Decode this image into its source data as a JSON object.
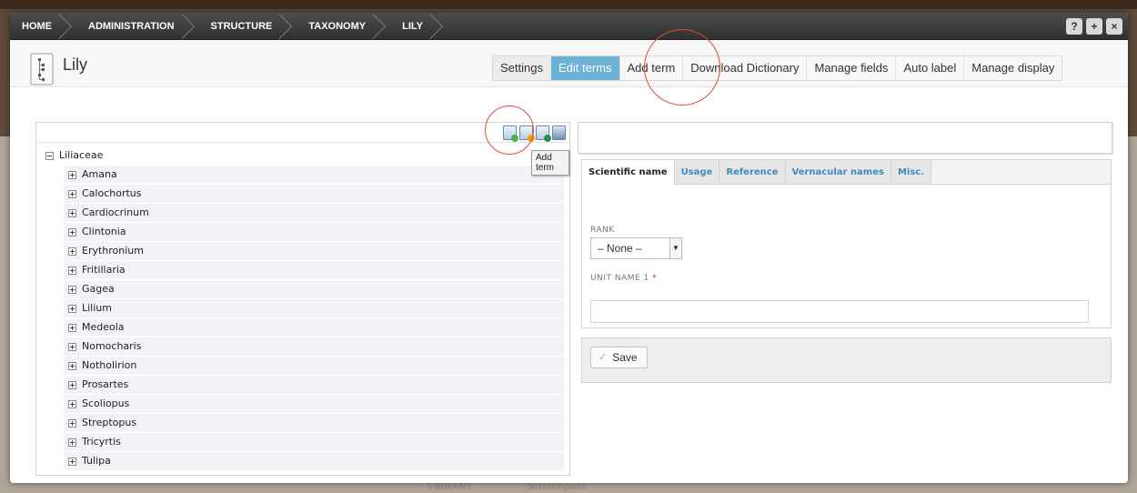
{
  "breadcrumbs": [
    "HOME",
    "ADMINISTRATION",
    "STRUCTURE",
    "TAXONOMY",
    "LILY"
  ],
  "toolbar_buttons": [
    "?",
    "+",
    "×"
  ],
  "page": {
    "title": "Lily",
    "icon": "taxonomy-tree-icon"
  },
  "tabs": [
    {
      "label": "Settings",
      "active": false
    },
    {
      "label": "Edit terms",
      "active": true
    },
    {
      "label": "Add term",
      "active": false
    },
    {
      "label": "Download Dictionary",
      "active": false
    },
    {
      "label": "Manage fields",
      "active": false
    },
    {
      "label": "Auto label",
      "active": false
    },
    {
      "label": "Manage display",
      "active": false
    }
  ],
  "tree_tools": [
    "add-term-icon",
    "add-child-term-icon",
    "move-term-icon",
    "print-icon"
  ],
  "tooltip": "Add term",
  "tree": {
    "root": "Liliaceae",
    "children": [
      "Amana",
      "Calochortus",
      "Cardiocrinum",
      "Clintonia",
      "Erythronium",
      "Fritillaria",
      "Gagea",
      "Lilium",
      "Medeola",
      "Nomocharis",
      "Notholirion",
      "Prosartes",
      "Scoliopus",
      "Streptopus",
      "Tricyrtis",
      "Tulipa"
    ]
  },
  "form": {
    "tabs": [
      "Scientific name",
      "Usage",
      "Reference",
      "Vernacular names",
      "Misc."
    ],
    "active_tab": "Scientific name",
    "rank_label": "RANK",
    "rank_value": "– None –",
    "unit_name_label": "UNIT NAME 1",
    "required_marker": "*",
    "save_label": "Save"
  },
  "background_footer": [
    "VIBRANT",
    "Scratchpads"
  ],
  "colors": {
    "accent": "#6bb2d6",
    "annotation": "#e0483f",
    "link": "#3c8dbd"
  }
}
